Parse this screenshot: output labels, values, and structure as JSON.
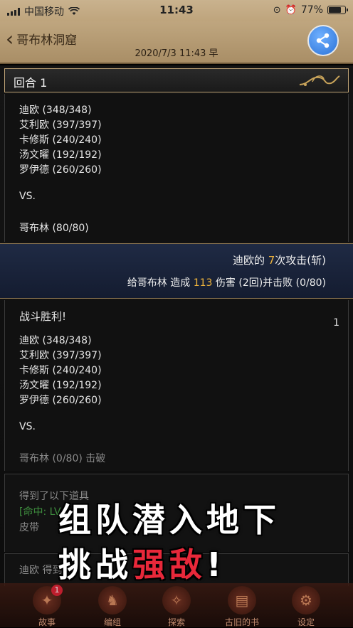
{
  "status_bar": {
    "carrier": "中国移动",
    "time": "11:43",
    "battery": "77%",
    "battery_level": 0.77
  },
  "header": {
    "back_label": "哥布林洞窟",
    "datetime": "2020/7/3 11:43 早"
  },
  "round": {
    "title": "回合 1"
  },
  "party_before": [
    "迪欧 (348/348)",
    "艾利欧 (397/397)",
    "卡修斯 (240/240)",
    "汤文曜 (192/192)",
    "罗伊德 (260/260)"
  ],
  "vs": "VS.",
  "enemy_before": "哥布林 (80/80)",
  "attack": {
    "line1_pre": "迪欧的 ",
    "line1_num": "7",
    "line1_post": "次攻击(斩)",
    "line2_pre": "给哥布林 造成 ",
    "line2_num": "113",
    "line2_post": " 伤害 (2回)并击败 (0/80)"
  },
  "result": {
    "title": "战斗胜利!",
    "counter": "1",
    "party": [
      "迪欧 (348/348)",
      "艾利欧 (397/397)",
      "卡修斯 (240/240)",
      "汤文曜 (192/192)",
      "罗伊德 (260/260)"
    ],
    "vs": "VS.",
    "enemy": "哥布林 (0/80) 击破"
  },
  "loot": {
    "line1": "得到了以下道具",
    "line2": "[命中: LV",
    "line3": "皮带"
  },
  "footer_log": {
    "line1": "迪欧 得到"
  },
  "promo": {
    "line1": "组队潜入地下",
    "line2_pre": "挑战",
    "line2_red": "强敌",
    "line2_post": "!"
  },
  "tabs": [
    {
      "label": "故事",
      "badge": "1",
      "icon": "story-icon"
    },
    {
      "label": "编组",
      "icon": "team-icon"
    },
    {
      "label": "探索",
      "icon": "explore-icon"
    },
    {
      "label": "古旧的书",
      "icon": "book-icon"
    },
    {
      "label": "设定",
      "icon": "settings-icon"
    }
  ]
}
